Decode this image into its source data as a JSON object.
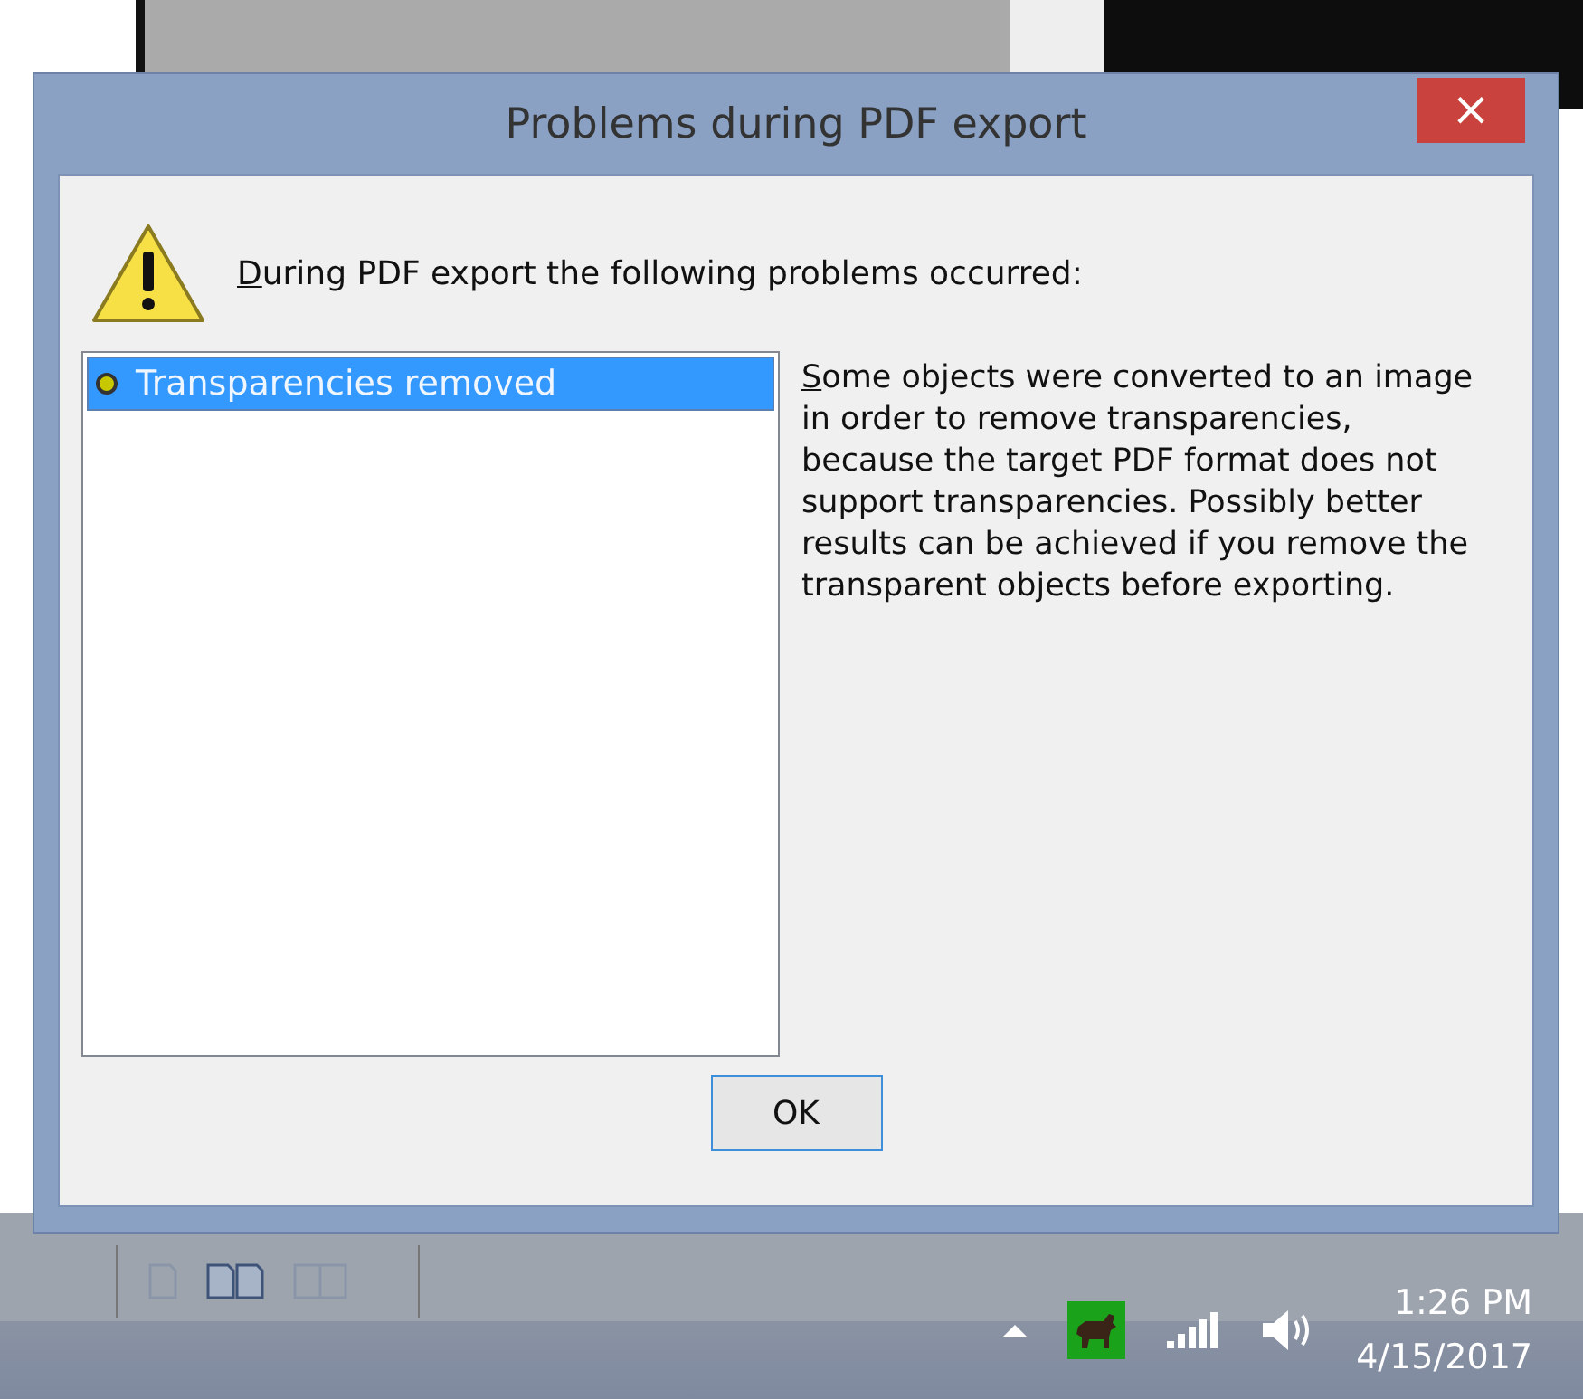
{
  "window": {
    "title": "Problems during PDF export",
    "close": "×"
  },
  "message": "During PDF export the following problems occurred:",
  "problems": [
    {
      "label": "Transparencies removed",
      "selected": true
    }
  ],
  "description": "Some objects were converted to an image in order to remove transparencies, because the target PDF format does not support transparencies. Possibly better results can be achieved if you remove the transparent objects before exporting.",
  "buttons": [
    "OK"
  ],
  "taskbar": {
    "time": "1:26 PM",
    "date": "4/15/2017"
  }
}
